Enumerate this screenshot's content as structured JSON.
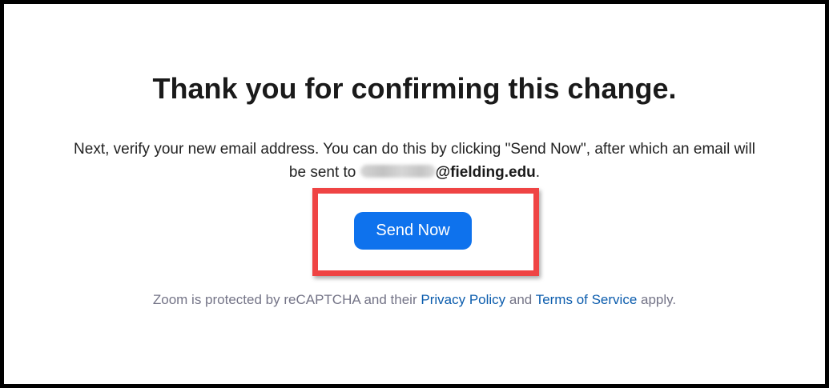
{
  "page": {
    "title": "Thank you for confirming this change.",
    "instructions_line1": "Next, verify your new email address. You can do this by clicking \"Send Now\", after which an email will",
    "instructions_prefix": "be sent to ",
    "email_domain": "@fielding.edu",
    "instructions_suffix": "."
  },
  "actions": {
    "send_now_label": "Send Now"
  },
  "footer": {
    "prefix": "Zoom is protected by reCAPTCHA and their ",
    "privacy_link": "Privacy Policy",
    "middle": " and ",
    "terms_link": "Terms of Service",
    "suffix": " apply."
  },
  "colors": {
    "button": "#0e72ed",
    "highlight": "#ef4444",
    "link": "#0b5cad",
    "footer_text": "#747487"
  }
}
